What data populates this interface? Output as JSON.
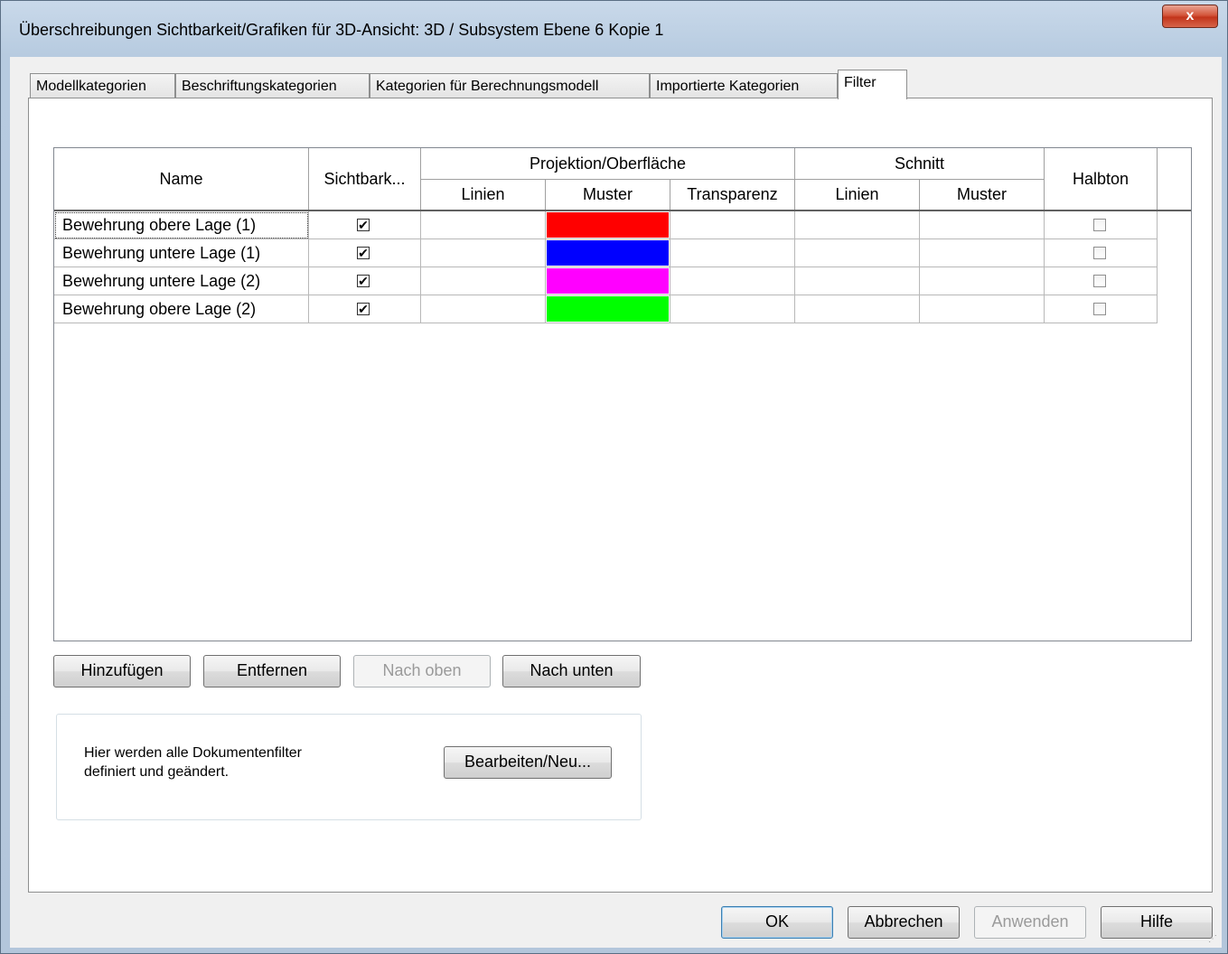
{
  "window": {
    "title": "Überschreibungen Sichtbarkeit/Grafiken für 3D-Ansicht: 3D / Subsystem Ebene 6 Kopie 1",
    "close_label": "x"
  },
  "tabs": [
    {
      "label": "Modellkategorien"
    },
    {
      "label": "Beschriftungskategorien"
    },
    {
      "label": "Kategorien für Berechnungsmodell"
    },
    {
      "label": "Importierte Kategorien"
    },
    {
      "label": "Filter",
      "active": true
    }
  ],
  "table": {
    "headers": {
      "name": "Name",
      "visibility": "Sichtbark...",
      "projection": "Projektion/Oberfläche",
      "proj_lines": "Linien",
      "proj_pattern": "Muster",
      "proj_transparency": "Transparenz",
      "section": "Schnitt",
      "sec_lines": "Linien",
      "sec_pattern": "Muster",
      "halftone": "Halbton"
    },
    "rows": [
      {
        "name": "Bewehrung obere Lage (1)",
        "visible": true,
        "pattern_color": "#ff0000",
        "halftone": false
      },
      {
        "name": "Bewehrung untere Lage (1)",
        "visible": true,
        "pattern_color": "#0000ff",
        "halftone": false
      },
      {
        "name": "Bewehrung untere Lage (2)",
        "visible": true,
        "pattern_color": "#ff00ff",
        "halftone": false
      },
      {
        "name": "Bewehrung obere Lage (2)",
        "visible": true,
        "pattern_color": "#00ff00",
        "halftone": false
      }
    ]
  },
  "buttons": {
    "add": "Hinzufügen",
    "remove": "Entfernen",
    "move_up": "Nach oben",
    "move_down": "Nach unten",
    "edit_new": "Bearbeiten/Neu...",
    "ok": "OK",
    "cancel": "Abbrechen",
    "apply": "Anwenden",
    "help": "Hilfe"
  },
  "info": {
    "line1": "Hier werden alle Dokumentenfilter",
    "line2": "definiert und geändert."
  }
}
